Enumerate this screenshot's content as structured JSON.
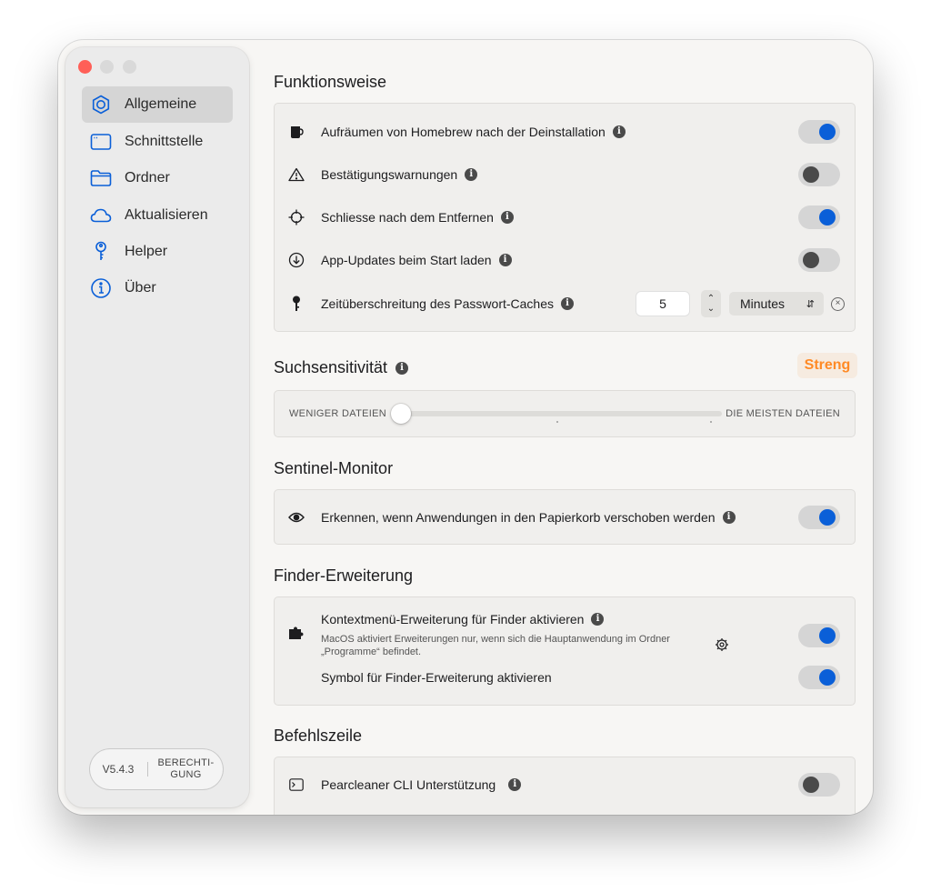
{
  "sidebar": {
    "items": [
      {
        "label": "Allgemeine",
        "icon": "gear-icon",
        "active": true
      },
      {
        "label": "Schnittstelle",
        "icon": "window-icon",
        "active": false
      },
      {
        "label": "Ordner",
        "icon": "folder-icon",
        "active": false
      },
      {
        "label": "Aktualisieren",
        "icon": "cloud-icon",
        "active": false
      },
      {
        "label": "Helper",
        "icon": "key-icon",
        "active": false
      },
      {
        "label": "Über",
        "icon": "info-icon",
        "active": false
      }
    ],
    "version": "V5.4.3",
    "permission_label": "BERECHTI-GUNG",
    "permission_line1": "BERECHTI-",
    "permission_line2": "GUNG"
  },
  "functionality": {
    "title": "Funktionsweise",
    "rows": [
      {
        "label": "Aufräumen von Homebrew nach der Deinstallation",
        "icon": "mug-icon",
        "toggle": true
      },
      {
        "label": "Bestätigungswarnungen",
        "icon": "warning-icon",
        "toggle": false
      },
      {
        "label": "Schliesse nach dem Entfernen",
        "icon": "crosshair-icon",
        "toggle": true
      },
      {
        "label": "App-Updates beim Start laden",
        "icon": "download-circle-icon",
        "toggle": false
      }
    ],
    "password_cache": {
      "label": "Zeitüberschreitung des Passwort-Caches",
      "icon": "key-icon",
      "value": "5",
      "unit": "Minutes"
    }
  },
  "search": {
    "title": "Suchsensitivität",
    "badge": "Streng",
    "min_label": "WENIGER DATEIEN",
    "max_label": "DIE MEISTEN DATEIEN",
    "level": 0
  },
  "sentinel": {
    "title": "Sentinel-Monitor",
    "label": "Erkennen, wenn Anwendungen in den Papierkorb verschoben werden",
    "icon": "eye-icon",
    "toggle": true
  },
  "finder": {
    "title": "Finder-Erweiterung",
    "context_label": "Kontextmenü-Erweiterung für Finder aktivieren",
    "context_note": "MacOS aktiviert Erweiterungen nur, wenn sich die Hauptanwendung im Ordner „Programme“ befindet.",
    "context_toggle": true,
    "symbol_label": "Symbol für Finder-Erweiterung aktivieren",
    "symbol_toggle": true,
    "icon": "puzzle-icon"
  },
  "cli": {
    "title": "Befehlszeile",
    "label": "Pearcleaner CLI Unterstützung",
    "icon": "terminal-icon",
    "toggle": false
  },
  "colors": {
    "accent": "#0a5fd8",
    "badge_text": "#ff8a25",
    "close_button": "#ff5f57"
  }
}
